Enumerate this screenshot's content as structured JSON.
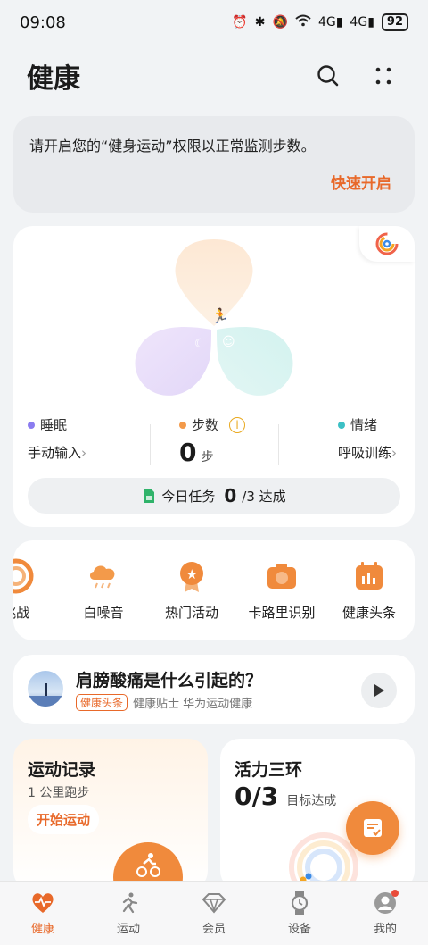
{
  "status": {
    "time": "09:08",
    "network": "4G",
    "network2": "4G",
    "battery": "92"
  },
  "header": {
    "title": "健康"
  },
  "permission": {
    "message": "请开启您的“健身运动”权限以正常监测步数。",
    "action": "快速开启"
  },
  "summary": {
    "sleep": {
      "label": "睡眠",
      "action": "手动输入",
      "color": "#8b7cf0"
    },
    "steps": {
      "label": "步数",
      "value": "0",
      "unit": "步",
      "color": "#f39a4a"
    },
    "mood": {
      "label": "情绪",
      "action": "呼吸训练",
      "color": "#3cc0c5"
    },
    "task": {
      "label": "今日任务",
      "done": "0",
      "total": "/3 达成"
    }
  },
  "shortcuts": [
    {
      "label": "挑战"
    },
    {
      "label": "白噪音"
    },
    {
      "label": "热门活动"
    },
    {
      "label": "卡路里识别"
    },
    {
      "label": "健康头条"
    }
  ],
  "news": {
    "headline": "肩膀酸痛是什么引起的？",
    "tag": "健康头条",
    "source": "健康贴士 华为运动健康"
  },
  "exercise": {
    "title": "运动记录",
    "subtitle": "1 公里跑步",
    "button": "开始运动"
  },
  "activity": {
    "title": "活力三环",
    "value": "0/3",
    "caption": "目标达成"
  },
  "tabs": [
    {
      "label": "健康"
    },
    {
      "label": "运动"
    },
    {
      "label": "会员"
    },
    {
      "label": "设备"
    },
    {
      "label": "我的"
    }
  ],
  "colors": {
    "accent": "#e8692a"
  }
}
